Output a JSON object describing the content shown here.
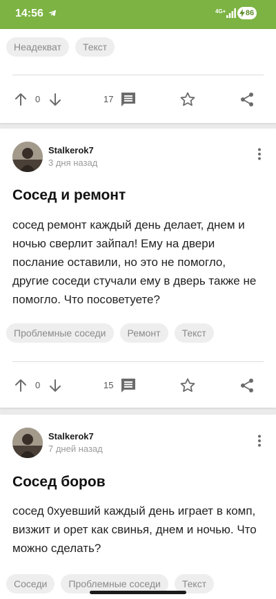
{
  "status_bar": {
    "time": "14:56",
    "network": "4G+",
    "battery": "86"
  },
  "posts": [
    {
      "tags": [
        "Неадекват",
        "Текст"
      ],
      "votes": "0",
      "comments": "17"
    },
    {
      "author": "Stalkerok7",
      "date": "3 дня назад",
      "title": "Сосед и ремонт",
      "body": "сосед ремонт каждый день делает, днем и ночью сверлит зайпал! Ему на двери послание оставили, но это не помогло, другие соседи стучали ему в дверь также не помогло. Что посоветуете?",
      "tags": [
        "Проблемные соседи",
        "Ремонт",
        "Текст"
      ],
      "votes": "0",
      "comments": "15"
    },
    {
      "author": "Stalkerok7",
      "date": "7 дней назад",
      "title": "Сосед боров",
      "body": "сосед 0хуевший каждый день играет в комп, визжит и орет как свинья, днем и ночью. Что можно сделать?",
      "tags": [
        "Соседи",
        "Проблемные соседи",
        "Текст"
      ]
    }
  ],
  "colors": {
    "status_bar": "#7cb342",
    "icon": "#6b6b6b",
    "tag_bg": "#eeeeee",
    "tag_text": "#8a8a8a"
  }
}
